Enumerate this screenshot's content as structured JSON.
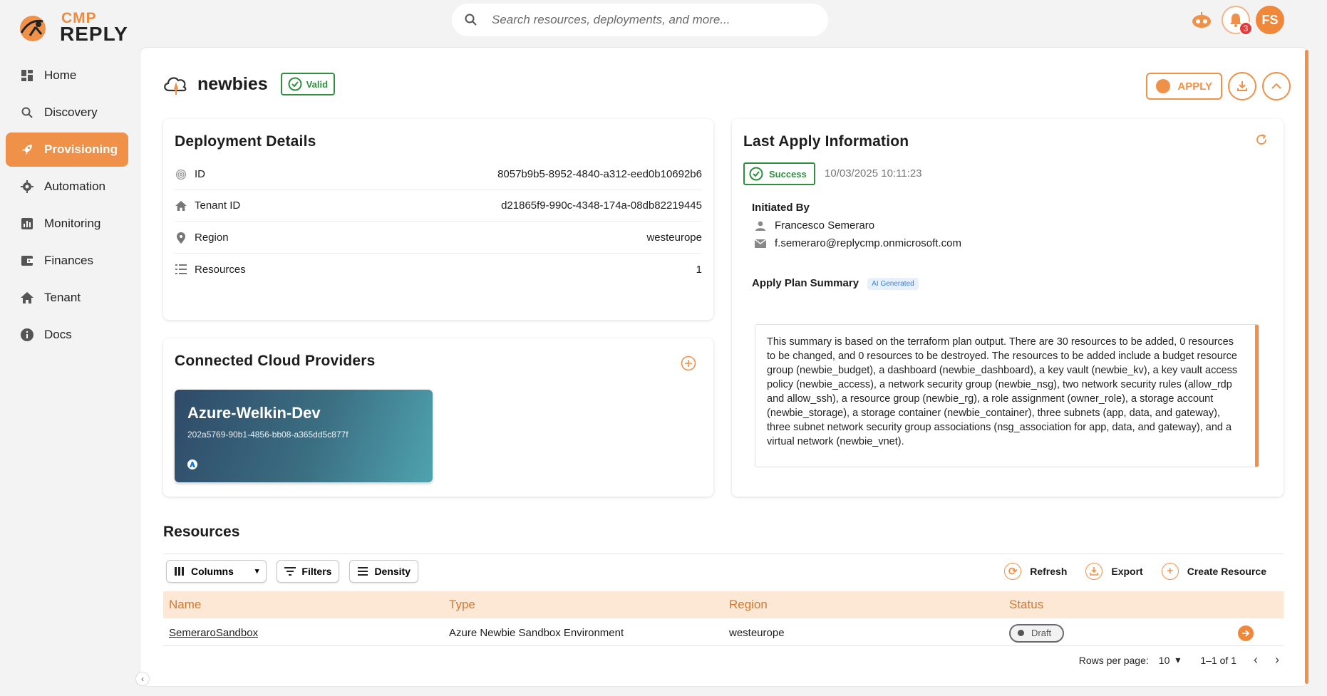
{
  "app": {
    "logo_top": "CMP",
    "logo_bottom": "REPLY"
  },
  "search": {
    "placeholder": "Search resources, deployments, and more..."
  },
  "topbar": {
    "notifications_count": "3",
    "avatar_initials": "FS"
  },
  "sidebar": {
    "items": [
      {
        "label": "Home",
        "icon": "grid-icon"
      },
      {
        "label": "Discovery",
        "icon": "search-icon"
      },
      {
        "label": "Provisioning",
        "icon": "rocket-icon",
        "active": true
      },
      {
        "label": "Automation",
        "icon": "gear-icon"
      },
      {
        "label": "Monitoring",
        "icon": "chart-icon"
      },
      {
        "label": "Finances",
        "icon": "wallet-icon"
      },
      {
        "label": "Tenant",
        "icon": "home-icon"
      },
      {
        "label": "Docs",
        "icon": "info-icon"
      }
    ]
  },
  "deployment": {
    "name": "newbies",
    "status": "Valid",
    "apply_label": "APPLY"
  },
  "details": {
    "title": "Deployment Details",
    "rows": [
      {
        "label": "ID",
        "value": "8057b9b5-8952-4840-a312-eed0b10692b6",
        "icon": "fingerprint-icon"
      },
      {
        "label": "Tenant ID",
        "value": "d21865f9-990c-4348-174a-08db82219445",
        "icon": "home-icon"
      },
      {
        "label": "Region",
        "value": "westeurope",
        "icon": "pin-icon"
      },
      {
        "label": "Resources",
        "value": "1",
        "icon": "list-icon"
      }
    ]
  },
  "providers": {
    "title": "Connected Cloud Providers",
    "items": [
      {
        "name": "Azure-Welkin-Dev",
        "id": "202a5769-90b1-4856-bb08-a365dd5c877f"
      }
    ]
  },
  "last_apply": {
    "title": "Last Apply Information",
    "status": "Success",
    "timestamp": "10/03/2025 10:11:23",
    "initiated_by_label": "Initiated By",
    "user_name": "Francesco Semeraro",
    "user_email": "f.semeraro@replycmp.onmicrosoft.com",
    "summary_label": "Apply Plan Summary",
    "ai_badge": "AI Generated",
    "summary_text": "This summary is based on the terraform plan output. There are 30 resources to be added, 0 resources to be changed, and 0 resources to be destroyed. The resources to be added include a budget resource group (newbie_budget), a dashboard (newbie_dashboard), a key vault (newbie_kv), a key vault access policy (newbie_access), a network security group (newbie_nsg), two network security rules (allow_rdp and allow_ssh), a resource group (newbie_rg), a role assignment (owner_role), a storage account (newbie_storage), a storage container (newbie_container), three subnets (app, data, and gateway), three subnet network security group associations (nsg_association for app, data, and gateway), and a virtual network (newbie_vnet)."
  },
  "resources": {
    "title": "Resources",
    "toolbar": {
      "columns": "Columns",
      "filters": "Filters",
      "density": "Density",
      "refresh": "Refresh",
      "export": "Export",
      "create": "Create Resource"
    },
    "columns": [
      "Name",
      "Type",
      "Region",
      "Status"
    ],
    "rows": [
      {
        "name": "SemeraroSandbox",
        "type": "Azure Newbie Sandbox Environment",
        "region": "westeurope",
        "status": "Draft"
      }
    ],
    "pagination": {
      "rows_per_page_label": "Rows per page:",
      "rows_per_page": "10",
      "range": "1–1 of 1"
    }
  },
  "colors": {
    "accent": "#f0914a",
    "success": "#2f8f3f",
    "header_bg": "#fde8d6"
  }
}
